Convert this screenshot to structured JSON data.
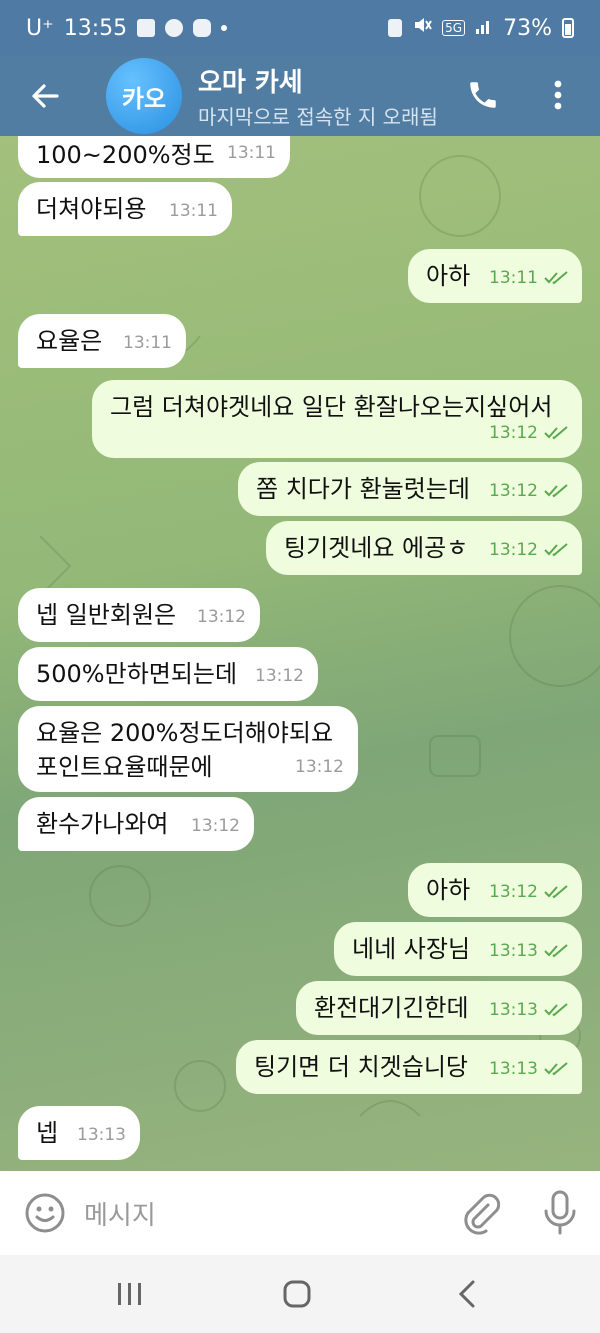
{
  "status_bar": {
    "carrier": "U⁺",
    "time": "13:55",
    "battery": "73%",
    "network": "5G"
  },
  "header": {
    "avatar_text": "카오",
    "title": "오마 카세",
    "subtitle": "마지막으로 접속한 지 오래됨"
  },
  "messages": [
    {
      "text": "100~200%정도",
      "time": "13:11",
      "dir": "in"
    },
    {
      "text": "더쳐야되용",
      "time": "13:11",
      "dir": "in"
    },
    {
      "text": "아하",
      "time": "13:11",
      "dir": "out"
    },
    {
      "text": "요율은",
      "time": "13:11",
      "dir": "in"
    },
    {
      "text": "그럼 더쳐야겟네요 일단 환잘나오는지싶어서",
      "time": "13:12",
      "dir": "out"
    },
    {
      "text": "쫌 치다가 환눌럿는데",
      "time": "13:12",
      "dir": "out"
    },
    {
      "text": "팅기겟네요 에공ㅎ",
      "time": "13:12",
      "dir": "out"
    },
    {
      "text": "넵 일반회원은",
      "time": "13:12",
      "dir": "in"
    },
    {
      "text": "500%만하면되는데",
      "time": "13:12",
      "dir": "in"
    },
    {
      "text": "요율은 200%정도더해야되요",
      "text2": "포인트요율때문에",
      "time": "13:12",
      "dir": "in"
    },
    {
      "text": "환수가나와여",
      "time": "13:12",
      "dir": "in"
    },
    {
      "text": "아하",
      "time": "13:12",
      "dir": "out"
    },
    {
      "text": "네네 사장님",
      "time": "13:13",
      "dir": "out"
    },
    {
      "text": "환전대기긴한데",
      "time": "13:13",
      "dir": "out"
    },
    {
      "text": "팅기면 더 치겟습니당",
      "time": "13:13",
      "dir": "out"
    },
    {
      "text": "넵",
      "time": "13:13",
      "dir": "in"
    }
  ],
  "input": {
    "placeholder": "메시지"
  },
  "colors": {
    "header": "#517da2",
    "outgoing_bubble": "#effdde",
    "incoming_bubble": "#ffffff",
    "read_check": "#5aa94e"
  }
}
